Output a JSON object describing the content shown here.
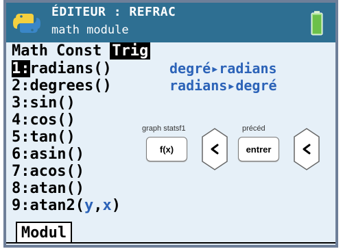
{
  "header": {
    "title": "ÉDITEUR : REFRAC",
    "subtitle": "math module",
    "icon": "python-logo",
    "battery_icon": "battery-icon",
    "colors": {
      "header_bg": "#2e6f92",
      "accent": "#2c63b8"
    }
  },
  "menu": {
    "tabs": [
      "Math",
      "Const",
      "Trig"
    ],
    "active_tab": "Trig"
  },
  "items": [
    {
      "num": "1:",
      "label": "radians()"
    },
    {
      "num": "2:",
      "label": "degrees()"
    },
    {
      "num": "3:",
      "label": "sin()"
    },
    {
      "num": "4:",
      "label": "cos()"
    },
    {
      "num": "5:",
      "label": "tan()"
    },
    {
      "num": "6:",
      "label": "asin()"
    },
    {
      "num": "7:",
      "label": "acos()"
    },
    {
      "num": "8:",
      "label": "atan()"
    },
    {
      "num": "9:",
      "label": "atan2(",
      "arg1": "y",
      "comma": ",",
      "arg2": "x",
      "close": ")"
    }
  ],
  "descriptions": {
    "radians": "degré▸radians",
    "degrees": "radians▸degré"
  },
  "keys": {
    "fx_label": "graph statsf1",
    "fx_button": "f(x)",
    "enter_label": "précéd",
    "enter_button": "entrer"
  },
  "footer": {
    "tab": "Modul"
  }
}
